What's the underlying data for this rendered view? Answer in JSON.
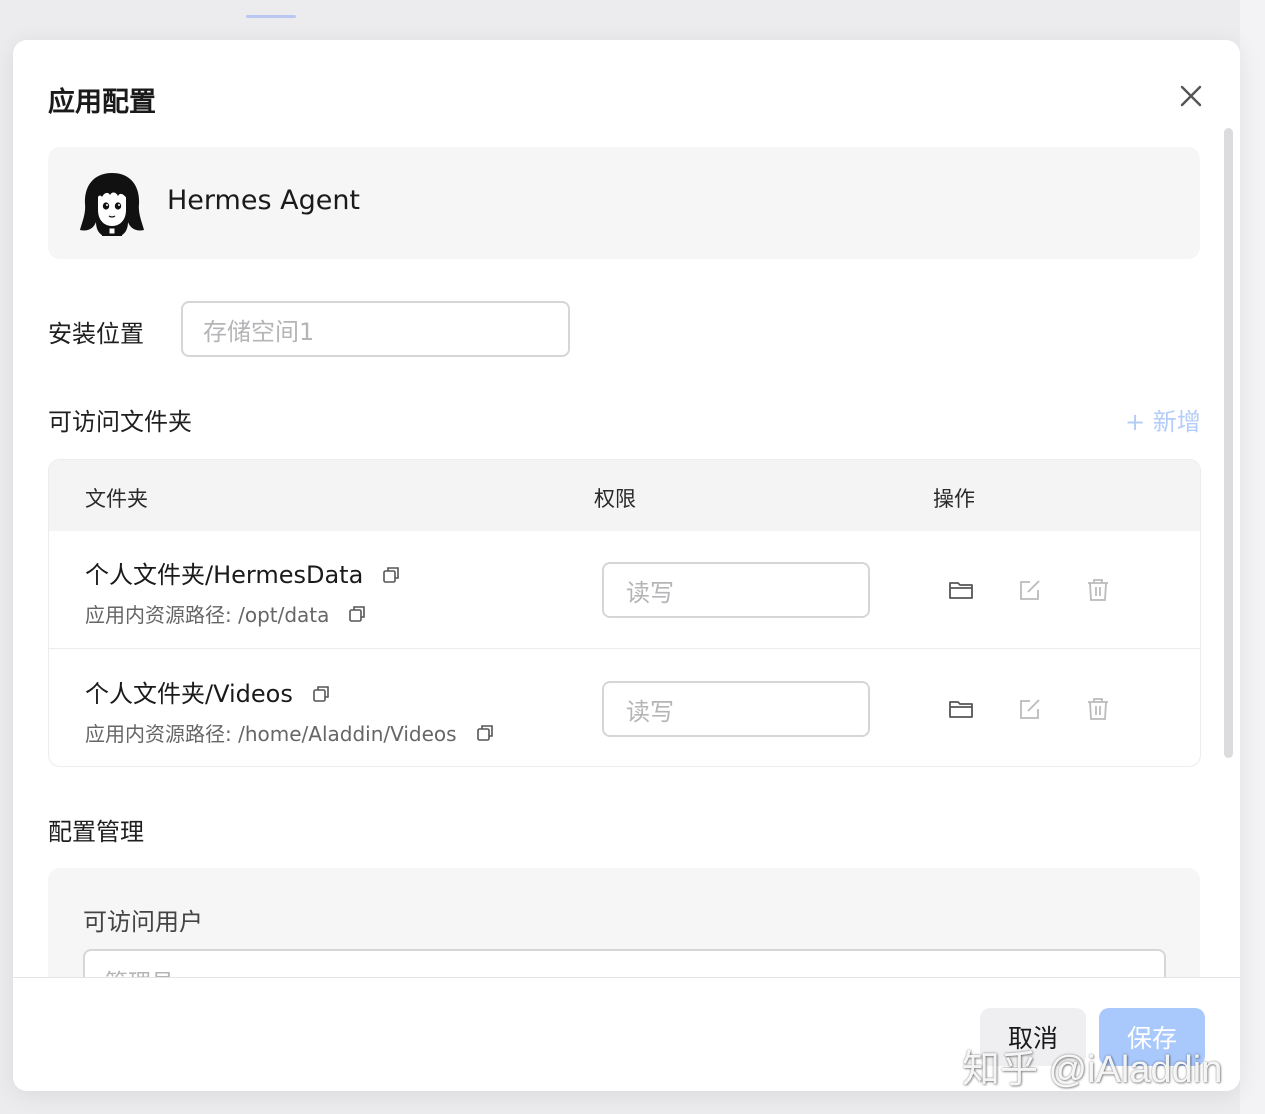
{
  "dialog": {
    "title": "应用配置",
    "app_name": "Hermes Agent",
    "avatar_icon": "anime-girl-avatar"
  },
  "install": {
    "label": "安装位置",
    "placeholder": "存储空间1"
  },
  "folders": {
    "section_title": "可访问文件夹",
    "add_label": "+ 新增",
    "columns": [
      "文件夹",
      "权限",
      "操作"
    ],
    "rows": [
      {
        "name": "个人文件夹/HermesData",
        "path": "应用内资源路径: /opt/data",
        "permission": "读写"
      },
      {
        "name": "个人文件夹/Videos",
        "path": "应用内资源路径: /home/Aladdin/Videos",
        "permission": "读写"
      }
    ],
    "action_icons": [
      "folder-icon",
      "edit-icon",
      "trash-icon"
    ]
  },
  "config": {
    "section_title": "配置管理",
    "users_label": "可访问用户",
    "users_value": "管理员"
  },
  "footer": {
    "cancel_label": "取消",
    "save_label": "保存"
  },
  "watermark": "知乎 @iAladdin",
  "colors": {
    "accent": "#a9c8fb",
    "add_link": "#b3cdf8",
    "card_bg": "#f6f6f7",
    "table_header_bg": "#f4f4f5"
  }
}
